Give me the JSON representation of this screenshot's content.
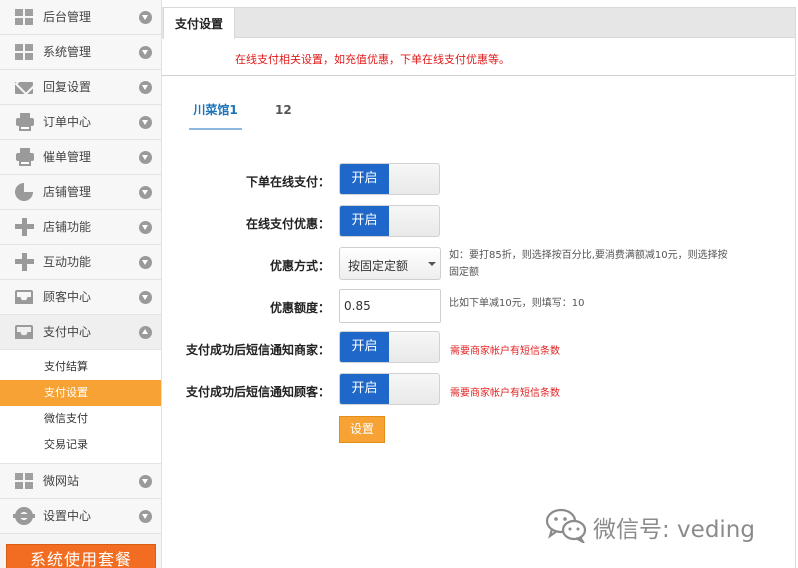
{
  "sidebar": {
    "menu": [
      {
        "label": "后台管理",
        "icon": "grid-icon"
      },
      {
        "label": "系统管理",
        "icon": "grid-icon"
      },
      {
        "label": "回复设置",
        "icon": "mail-icon"
      },
      {
        "label": "订单中心",
        "icon": "printer-icon"
      },
      {
        "label": "催单管理",
        "icon": "printer-icon"
      },
      {
        "label": "店铺管理",
        "icon": "pie-chart-icon"
      },
      {
        "label": "店铺功能",
        "icon": "plus-icon"
      },
      {
        "label": "互动功能",
        "icon": "plus-icon"
      },
      {
        "label": "顾客中心",
        "icon": "inbox-icon"
      },
      {
        "label": "支付中心",
        "icon": "inbox-icon",
        "open": true
      }
    ],
    "submenu": [
      {
        "label": "支付结算"
      },
      {
        "label": "支付设置",
        "active": true
      },
      {
        "label": "微信支付"
      },
      {
        "label": "交易记录"
      }
    ],
    "menu_after": [
      {
        "label": "微网站",
        "icon": "grid-icon"
      },
      {
        "label": "设置中心",
        "icon": "gear-icon"
      }
    ],
    "promo_button": "系统使用套餐"
  },
  "top_tab": "支付设置",
  "notice": "在线支付相关设置，如充值优惠，下单在线支付优惠等。",
  "store_tabs": [
    "川菜馆1",
    "12"
  ],
  "form": {
    "online_pay": {
      "label": "下单在线支付：",
      "toggle": "开启"
    },
    "online_discount": {
      "label": "在线支付优惠：",
      "toggle": "开启"
    },
    "discount_mode": {
      "label": "优惠方式：",
      "value": "按固定定额",
      "hint_line1": "如：要打85折，则选择按百分比,要消费满额减10元，则选择按",
      "hint_line2": "固定额"
    },
    "discount_amount": {
      "label": "优惠额度：",
      "value": "0.85",
      "hint": "比如下单减10元，则填写：10"
    },
    "sms_merchant": {
      "label": "支付成功后短信通知商家：",
      "toggle": "开启",
      "warning": "需要商家帐户有短信条数"
    },
    "sms_customer": {
      "label": "支付成功后短信通知顾客：",
      "toggle": "开启",
      "warning": "需要商家帐户有短信条数"
    },
    "submit": "设置"
  },
  "watermark": "微信号: veding",
  "colors": {
    "accent_orange": "#f7a234",
    "toggle_blue": "#1f68c9",
    "notice_red": "#e01b1b",
    "tab_blue": "#1c73b9"
  }
}
